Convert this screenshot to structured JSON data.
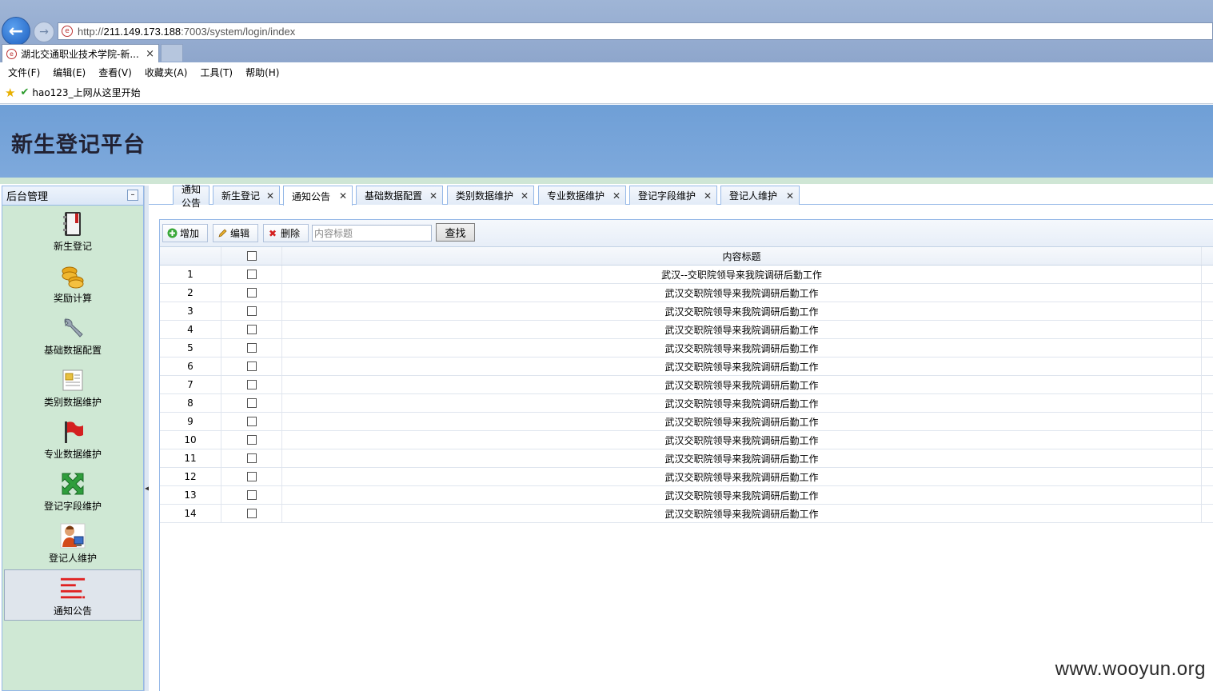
{
  "browser": {
    "url_prefix": "http://",
    "url_host": "211.149.173.188",
    "url_rest": ":7003/system/login/index",
    "tab_title": "湖北交通职业技术学院-新...",
    "tab_close": "×",
    "menu": [
      "文件(F)",
      "编辑(E)",
      "查看(V)",
      "收藏夹(A)",
      "工具(T)",
      "帮助(H)"
    ],
    "favorites": [
      "hao123_上网从这里开始"
    ]
  },
  "app": {
    "title": "新生登记平台"
  },
  "sidebar": {
    "title": "后台管理",
    "items": [
      {
        "label": "新生登记",
        "icon": "notebook-icon"
      },
      {
        "label": "奖励计算",
        "icon": "coins-icon"
      },
      {
        "label": "基础数据配置",
        "icon": "wrench-icon"
      },
      {
        "label": "类别数据维护",
        "icon": "folder-document-icon"
      },
      {
        "label": "专业数据维护",
        "icon": "flag-icon"
      },
      {
        "label": "登记字段维护",
        "icon": "arrows-icon"
      },
      {
        "label": "登记人维护",
        "icon": "user-computer-icon"
      },
      {
        "label": "通知公告",
        "icon": "list-icon"
      }
    ]
  },
  "tabs": [
    {
      "label": "通知公告",
      "closable": false
    },
    {
      "label": "新生登记",
      "closable": true
    },
    {
      "label": "通知公告",
      "closable": true,
      "active": true
    },
    {
      "label": "基础数据配置",
      "closable": true
    },
    {
      "label": "类别数据维护",
      "closable": true
    },
    {
      "label": "专业数据维护",
      "closable": true
    },
    {
      "label": "登记字段维护",
      "closable": true
    },
    {
      "label": "登记人维护",
      "closable": true
    }
  ],
  "toolbar": {
    "add_label": "增加",
    "edit_label": "编辑",
    "delete_label": "删除",
    "search_placeholder": "内容标题",
    "find_label": "查找"
  },
  "grid": {
    "columns": [
      "内容标题"
    ],
    "rows": [
      {
        "num": "1",
        "title": "武汉--交职院领导来我院调研后勤工作"
      },
      {
        "num": "2",
        "title": "武汉交职院领导来我院调研后勤工作"
      },
      {
        "num": "3",
        "title": "武汉交职院领导来我院调研后勤工作"
      },
      {
        "num": "4",
        "title": "武汉交职院领导来我院调研后勤工作"
      },
      {
        "num": "5",
        "title": "武汉交职院领导来我院调研后勤工作"
      },
      {
        "num": "6",
        "title": "武汉交职院领导来我院调研后勤工作"
      },
      {
        "num": "7",
        "title": "武汉交职院领导来我院调研后勤工作"
      },
      {
        "num": "8",
        "title": "武汉交职院领导来我院调研后勤工作"
      },
      {
        "num": "9",
        "title": "武汉交职院领导来我院调研后勤工作"
      },
      {
        "num": "10",
        "title": "武汉交职院领导来我院调研后勤工作"
      },
      {
        "num": "11",
        "title": "武汉交职院领导来我院调研后勤工作"
      },
      {
        "num": "12",
        "title": "武汉交职院领导来我院调研后勤工作"
      },
      {
        "num": "13",
        "title": "武汉交职院领导来我院调研后勤工作"
      },
      {
        "num": "14",
        "title": "武汉交职院领导来我院调研后勤工作"
      }
    ]
  },
  "watermark": "www.wooyun.org",
  "colors": {
    "header_bg": "#7ea9dc",
    "sidebar_bg": "#cfe8d4",
    "border": "#95b8e7"
  }
}
